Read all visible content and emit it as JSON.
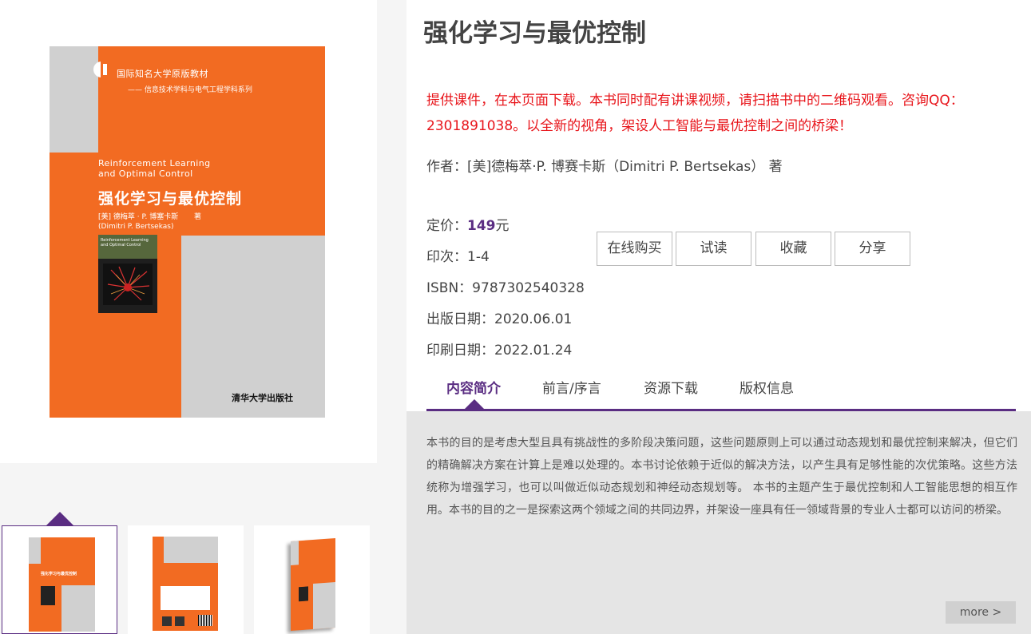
{
  "cover": {
    "series_line1": "国际知名大学原版教材",
    "series_line2": "—— 信息技术学科与电气工程学科系列",
    "en_title": "Reinforcement Learning\nand Optimal Control",
    "cn_title": "强化学习与最优控制",
    "author": "[美]  德梅萃 · P.  博塞卡斯\n        (Dimitri  P.  Bertsekas)",
    "author_suffix": "著",
    "mini_title": "Reinforcement Learning\nand Optimal Control",
    "publisher": "清华大学出版社",
    "colors": {
      "orange": "#f26b22",
      "grey": "#d0d0d0"
    }
  },
  "thumbnails": [
    {
      "name": "front-cover",
      "active": true
    },
    {
      "name": "back-cover",
      "active": false
    },
    {
      "name": "3d-cover",
      "active": false
    }
  ],
  "book": {
    "title": "强化学习与最优控制",
    "promo": "提供课件，在本页面下载。本书同时配有讲课视频，请扫描书中的二维码观看。咨询QQ：2301891038。以全新的视角，架设人工智能与最优控制之间的桥梁！",
    "author_line": "作者：[美]德梅萃·P. 博赛卡斯（Dimitri P. Bertsekas） 著",
    "price_label": "定价：",
    "price_value": "149",
    "price_unit": "元",
    "printing": "印次：1-4",
    "isbn": "ISBN：9787302540328",
    "pub_date": "出版日期：2020.06.01",
    "print_date": "印刷日期：2022.01.24"
  },
  "actions": {
    "buy": "在线购买",
    "preview": "试读",
    "favorite": "收藏",
    "share": "分享"
  },
  "tabs": [
    {
      "label": "内容简介",
      "active": true
    },
    {
      "label": "前言/序言",
      "active": false
    },
    {
      "label": "资源下载",
      "active": false
    },
    {
      "label": "版权信息",
      "active": false
    }
  ],
  "description": "本书的目的是考虑大型且具有挑战性的多阶段决策问题，这些问题原则上可以通过动态规划和最优控制来解决，但它们的精确解决方案在计算上是难以处理的。本书讨论依赖于近似的解决方法，以产生具有足够性能的次优策略。这些方法统称为增强学习，也可以叫做近似动态规划和神经动态规划等。 本书的主题产生于最优控制和人工智能思想的相互作用。本书的目的之一是探索这两个领域之间的共同边界，并架设一座具有任一领域背景的专业人士都可以访问的桥梁。",
  "more": "more >",
  "accent_color": "#5a2d82",
  "promo_color": "#e8141a"
}
